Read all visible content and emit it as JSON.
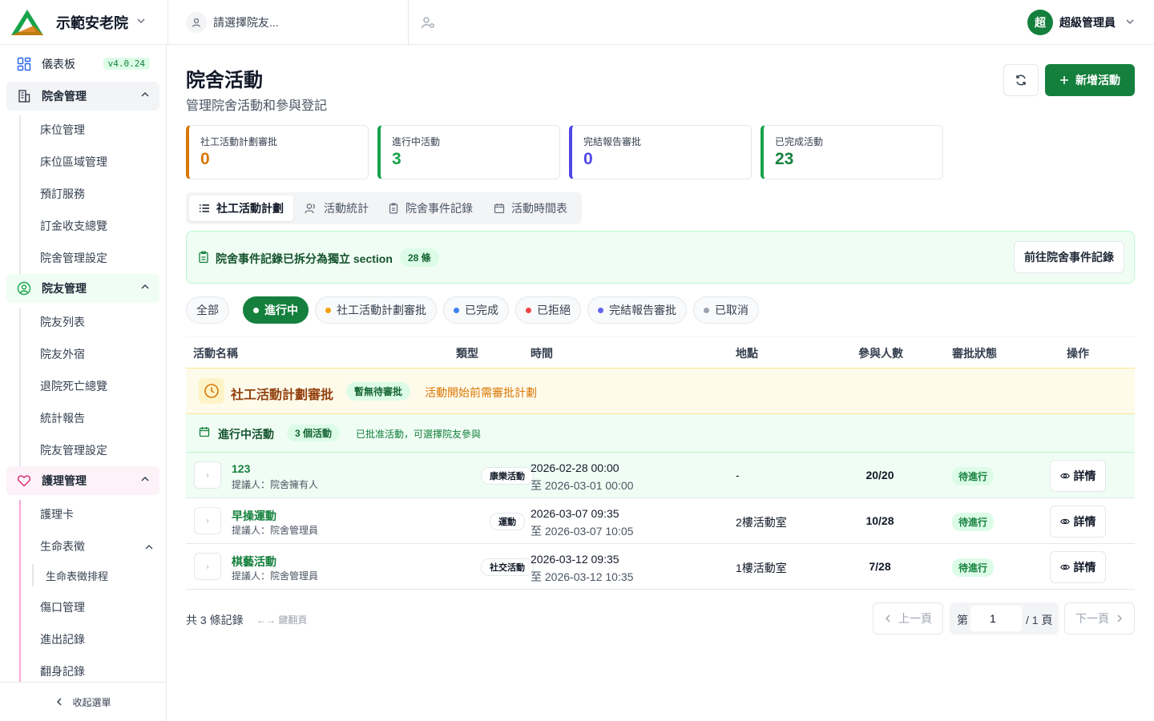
{
  "header": {
    "org_name": "示範安老院",
    "resident_placeholder": "請選擇院友...",
    "user_initial": "超",
    "user_name": "超級管理員"
  },
  "sidebar": {
    "dashboard": "儀表板",
    "version": "v4.0.24",
    "groups": [
      {
        "label": "院舍管理",
        "items": [
          "床位管理",
          "床位區域管理",
          "預訂服務",
          "訂金收支總覽",
          "院舍管理設定"
        ]
      },
      {
        "label": "院友管理",
        "items": [
          "院友列表",
          "院友外宿",
          "退院死亡總覽",
          "統計報告",
          "院友管理設定"
        ]
      },
      {
        "label": "護理管理",
        "items": [
          "護理卡",
          "生命表徵",
          "生命表徵排程",
          "傷口管理",
          "進出記錄",
          "翻身記錄"
        ]
      }
    ],
    "collapse_label": "收起選單"
  },
  "page": {
    "title": "院舍活動",
    "subtitle": "管理院舍活動和參與登記",
    "add_button": "新增活動"
  },
  "stats": [
    {
      "label": "社工活動計劃審批",
      "value": "0",
      "color": "#d97706"
    },
    {
      "label": "進行中活動",
      "value": "3",
      "color": "#16a34a"
    },
    {
      "label": "完結報告審批",
      "value": "0",
      "color": "#4f46e5"
    },
    {
      "label": "已完成活動",
      "value": "23",
      "color": "#16a34a"
    }
  ],
  "tabs": [
    "社工活動計劃",
    "活動統計",
    "院舍事件記錄",
    "活動時間表"
  ],
  "notice": {
    "text": "院舍事件記錄已拆分為獨立 section",
    "count": "28 條",
    "button": "前往院舍事件記錄"
  },
  "filters": [
    {
      "label": "全部",
      "dot": ""
    },
    {
      "label": "進行中",
      "dot": "#ffffff"
    },
    {
      "label": "社工活動計劃審批",
      "dot": "#f59e0b"
    },
    {
      "label": "已完成",
      "dot": "#3b82f6"
    },
    {
      "label": "已拒絕",
      "dot": "#ef4444"
    },
    {
      "label": "完結報告審批",
      "dot": "#6366f1"
    },
    {
      "label": "已取消",
      "dot": "#9ca3af"
    }
  ],
  "table": {
    "columns": [
      "活動名稱",
      "類型",
      "時間",
      "地點",
      "參與人數",
      "審批狀態",
      "操作"
    ],
    "pending_group": {
      "title": "社工活動計劃審批",
      "badge": "暫無待審批",
      "note": "活動開始前需審批計劃"
    },
    "active_group": {
      "title": "進行中活動",
      "badge": "3 個活動",
      "note": "已批准活動，可選擇院友參與"
    },
    "rows": [
      {
        "name": "123",
        "proposer": "提議人：院舍擁有人",
        "type": "康樂活動",
        "start": "2026-02-28 00:00",
        "end": "至 2026-03-01 00:00",
        "location": "-",
        "participants": "20/20",
        "status": "待進行",
        "action": "詳情"
      },
      {
        "name": "早操運動",
        "proposer": "提議人：院舍管理員",
        "type": "運動",
        "start": "2026-03-07 09:35",
        "end": "至 2026-03-07 10:05",
        "location": "2樓活動室",
        "participants": "10/28",
        "status": "待進行",
        "action": "詳情"
      },
      {
        "name": "棋藝活動",
        "proposer": "提議人：院舍管理員",
        "type": "社交活動",
        "start": "2026-03-12 09:35",
        "end": "至 2026-03-12 10:35",
        "location": "1樓活動室",
        "participants": "7/28",
        "status": "待進行",
        "action": "詳情"
      }
    ]
  },
  "pagination": {
    "total": "共 3 條記錄",
    "hint": "←→ 鍵翻頁",
    "prev": "上一頁",
    "page_prefix": "第",
    "page_value": "1",
    "page_suffix": "/ 1 頁",
    "next": "下一頁"
  }
}
